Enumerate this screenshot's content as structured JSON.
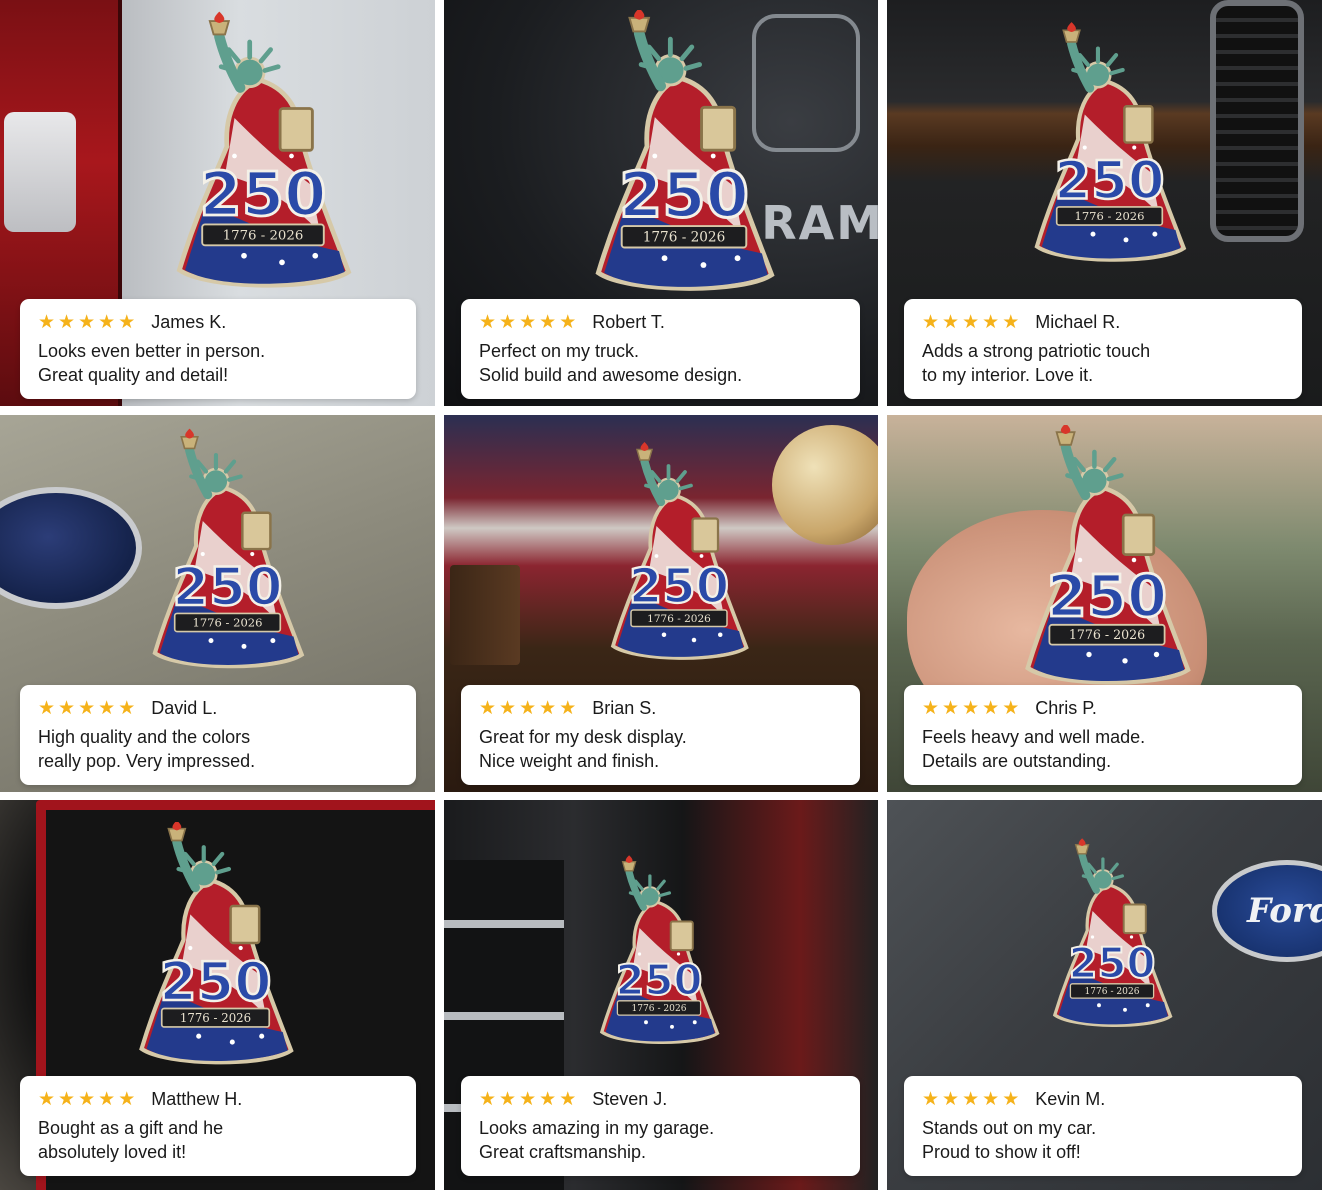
{
  "colors": {
    "star": "#f5b21a",
    "card": "#ffffff",
    "text": "#1a1a1a"
  },
  "emblem": {
    "number": "250",
    "years": "1776 - 2026",
    "tablet": "1776 2026"
  },
  "reviews": [
    {
      "rating": 5,
      "name": "James K.",
      "line1": "Looks even better in person.",
      "line2": "Great quality and detail!",
      "scene": "truck tailgate"
    },
    {
      "rating": 5,
      "name": "Robert T.",
      "line1": "Perfect on my truck.",
      "line2": "Solid build and awesome design.",
      "scene": "ram truck",
      "scene_text": "RAM"
    },
    {
      "rating": 5,
      "name": "Michael R.",
      "line1": "Adds a strong patriotic touch",
      "line2": "to my interior. Love it.",
      "scene": "car interior"
    },
    {
      "rating": 5,
      "name": "David L.",
      "line1": "High quality and the colors",
      "line2": "really pop. Very impressed.",
      "scene": "subaru"
    },
    {
      "rating": 5,
      "name": "Brian S.",
      "line1": "Great for my desk display.",
      "line2": "Nice weight and finish.",
      "scene": "desk"
    },
    {
      "rating": 5,
      "name": "Chris P.",
      "line1": "Feels heavy and well made.",
      "line2": "Details are outstanding.",
      "scene": "hand"
    },
    {
      "rating": 5,
      "name": "Matthew H.",
      "line1": "Bought as a gift and he",
      "line2": "absolutely loved it!",
      "scene": "gift box"
    },
    {
      "rating": 5,
      "name": "Steven J.",
      "line1": "Looks amazing in my garage.",
      "line2": "Great craftsmanship.",
      "scene": "tool chest"
    },
    {
      "rating": 5,
      "name": "Kevin M.",
      "line1": "Stands out on my car.",
      "line2": "Proud to show it off!",
      "scene": "ford",
      "scene_text": "Ford"
    }
  ]
}
